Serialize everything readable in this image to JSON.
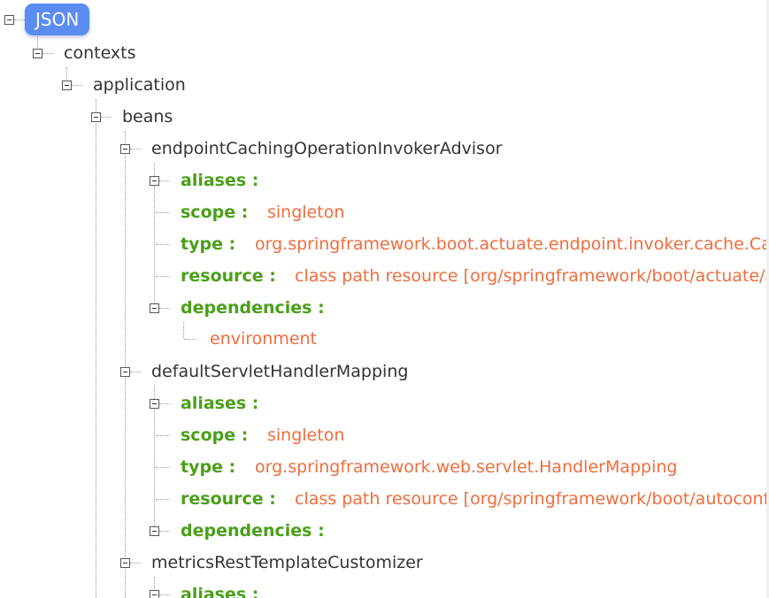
{
  "root": {
    "label": "JSON"
  },
  "nodes": {
    "contexts": "contexts",
    "application": "application",
    "beans": "beans",
    "bean1": {
      "name": "endpointCachingOperationInvokerAdvisor",
      "aliases_key": "aliases :",
      "scope_key": "scope :",
      "scope_value": "singleton",
      "type_key": "type :",
      "type_value": "org.springframework.boot.actuate.endpoint.invoker.cache.Cac",
      "resource_key": "resource :",
      "resource_value": "class path resource [org/springframework/boot/actuate/a",
      "dependencies_key": "dependencies :",
      "dependency_0": "environment"
    },
    "bean2": {
      "name": "defaultServletHandlerMapping",
      "aliases_key": "aliases :",
      "scope_key": "scope :",
      "scope_value": "singleton",
      "type_key": "type :",
      "type_value": "org.springframework.web.servlet.HandlerMapping",
      "resource_key": "resource :",
      "resource_value": "class path resource [org/springframework/boot/autoconfi",
      "dependencies_key": "dependencies :"
    },
    "bean3": {
      "name": "metricsRestTemplateCustomizer",
      "aliases_key": "aliases :"
    }
  },
  "colors": {
    "root_badge": "#5b8cf0",
    "key": "#4aa018",
    "value": "#f06c3c",
    "node_text": "#333333"
  },
  "icons": {
    "expanded_toggle": "minus-box-icon"
  }
}
